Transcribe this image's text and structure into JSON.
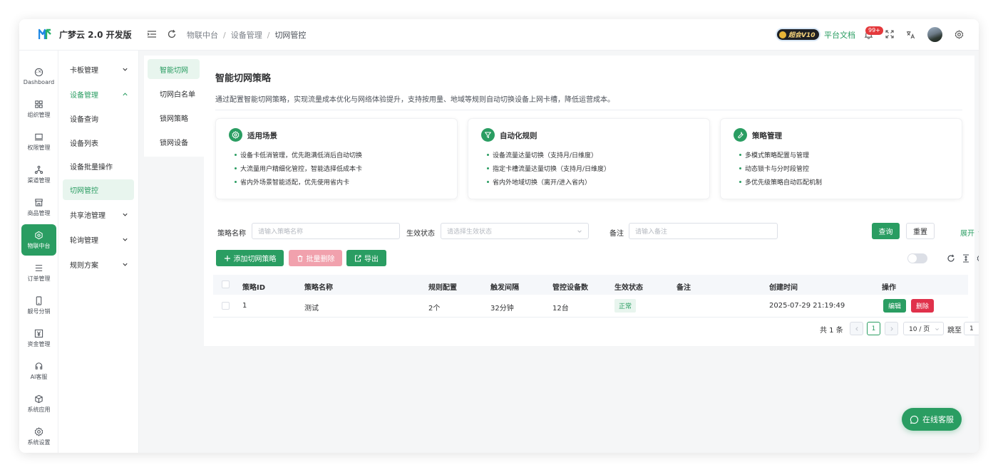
{
  "app": {
    "brand": "广梦云 2.0 开发版",
    "breadcrumbs": [
      "物联中台",
      "设备管理",
      "切网管控"
    ],
    "vip_label": "超会V10",
    "docs_link": "平台文档",
    "notification_badge": "99+"
  },
  "rail": [
    {
      "label": "Dashboard",
      "icon": "gauge-icon"
    },
    {
      "label": "组织管理",
      "icon": "grid-icon"
    },
    {
      "label": "权限管理",
      "icon": "monitor-icon"
    },
    {
      "label": "渠道管理",
      "icon": "network-icon"
    },
    {
      "label": "商品管理",
      "icon": "store-icon"
    },
    {
      "label": "物联中台",
      "icon": "hub-icon",
      "active": true
    },
    {
      "label": "订单管理",
      "icon": "list-icon"
    },
    {
      "label": "靓号分销",
      "icon": "phone-icon"
    },
    {
      "label": "资金管理",
      "icon": "yen-icon"
    },
    {
      "label": "AI客服",
      "icon": "headset-icon"
    },
    {
      "label": "系统应用",
      "icon": "cube-icon"
    },
    {
      "label": "系统设置",
      "icon": "gear-icon"
    }
  ],
  "submenu": [
    {
      "label": "卡板管理",
      "type": "group",
      "expanded": false
    },
    {
      "label": "设备管理",
      "type": "group",
      "expanded": true
    },
    {
      "label": "设备查询",
      "type": "item"
    },
    {
      "label": "设备列表",
      "type": "item"
    },
    {
      "label": "设备批量操作",
      "type": "item"
    },
    {
      "label": "切网管控",
      "type": "item",
      "active": true
    },
    {
      "label": "共享池管理",
      "type": "group",
      "expanded": false
    },
    {
      "label": "轮询管理",
      "type": "group",
      "expanded": false
    },
    {
      "label": "规则方案",
      "type": "group",
      "expanded": false
    }
  ],
  "tabs": [
    {
      "label": "智能切网",
      "active": true
    },
    {
      "label": "切网白名单"
    },
    {
      "label": "锁网策略"
    },
    {
      "label": "锁网设备"
    }
  ],
  "page": {
    "title": "智能切网策略",
    "description": "通过配置智能切网策略，实现流量成本优化与网络体验提升，支持按用量、地域等规则自动切换设备上网卡槽，降低运营成本。"
  },
  "cards": [
    {
      "title": "适用场景",
      "icon": "gear-icon",
      "items": [
        "设备卡低消管理，优先跑满低消后自动切换",
        "大流量用户精细化管控，智能选择低成本卡",
        "省内外场景智能适配，优先使用省内卡"
      ]
    },
    {
      "title": "自动化规则",
      "icon": "filter-icon",
      "items": [
        "设备流量达量切换（支持月/日维度）",
        "指定卡槽流量达量切换（支持月/日维度）",
        "省内外地域切换（离开/进入省内）"
      ]
    },
    {
      "title": "策略管理",
      "icon": "wrench-icon",
      "items": [
        "多模式策略配置与管理",
        "动态锁卡与分时段管控",
        "多优先级策略自动匹配机制"
      ]
    }
  ],
  "filters": {
    "name_label": "策略名称",
    "name_placeholder": "请输入策略名称",
    "status_label": "生效状态",
    "status_placeholder": "请选择生效状态",
    "remark_label": "备注",
    "remark_placeholder": "请输入备注",
    "search_btn": "查询",
    "reset_btn": "重置",
    "expand_btn": "展开"
  },
  "actions": {
    "add_btn": "添加切网策略",
    "batch_delete_btn": "批量删除",
    "export_btn": "导出"
  },
  "table": {
    "columns": [
      "策略ID",
      "策略名称",
      "规则配置",
      "触发间隔",
      "管控设备数",
      "生效状态",
      "备注",
      "创建时间",
      "操作"
    ],
    "rows": [
      {
        "id": "1",
        "name": "测试",
        "rules": "2个",
        "interval": "32分钟",
        "devices": "12台",
        "status": "正常",
        "remark": "",
        "created": "2025-07-29 21:19:49",
        "edit": "编辑",
        "delete": "删除"
      }
    ]
  },
  "pagination": {
    "total": "共 1 条",
    "current_page": "1",
    "page_size": "10 / 页",
    "goto_label": "跳至",
    "goto_value": "1"
  },
  "chat_button": "在线客服",
  "colors": {
    "primary": "#2a9d62",
    "danger": "#e0314b",
    "danger_light": "#f1a1ad"
  }
}
